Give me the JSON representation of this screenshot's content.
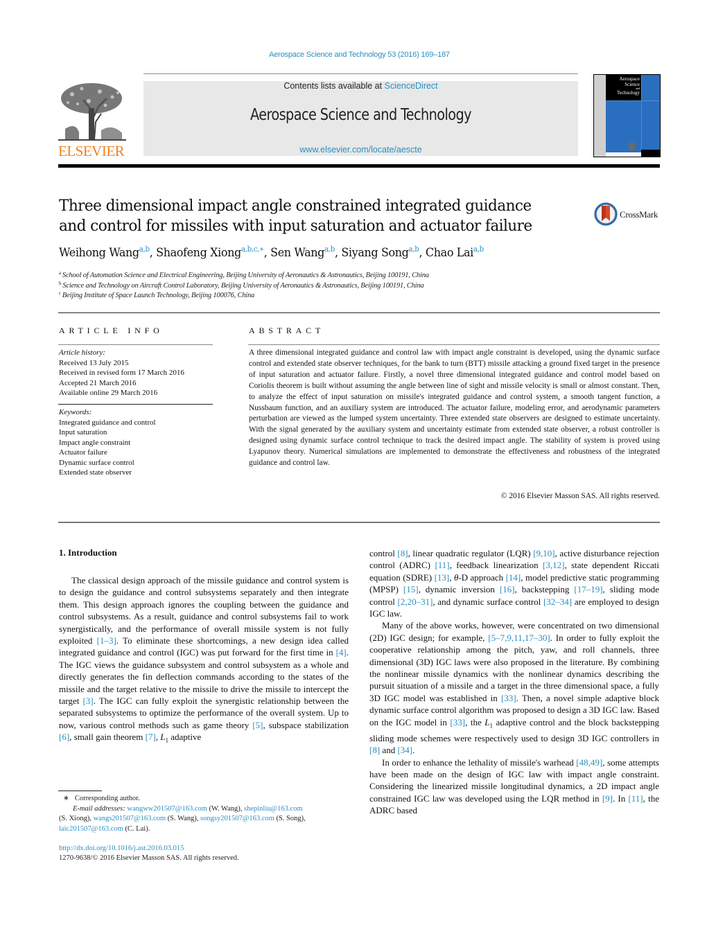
{
  "journal_ref": "Aerospace Science and Technology 53 (2016) 169–187",
  "masthead": {
    "contents_prefix": "Contents lists available at ",
    "contents_link": "ScienceDirect",
    "journal_title": "Aerospace Science and Technology",
    "journal_url": "www.elsevier.com/locate/aescte"
  },
  "publisher_logo_text": "ELSEVIER",
  "cover": {
    "title_line1": "Aerospace",
    "title_line2": "Science",
    "title_line3": "and",
    "title_line4": "Technology"
  },
  "crossmark_label": "CrossMark",
  "title": "Three dimensional impact angle constrained integrated guidance and control for missiles with input saturation and actuator failure",
  "authors": [
    {
      "name": "Weihong Wang",
      "affil": "a,b"
    },
    {
      "name": "Shaofeng Xiong",
      "affil": "a,b,c,∗"
    },
    {
      "name": "Sen Wang",
      "affil": "a,b"
    },
    {
      "name": "Siyang Song",
      "affil": "a,b"
    },
    {
      "name": "Chao Lai",
      "affil": "a,b"
    }
  ],
  "affiliations": [
    {
      "mark": "a",
      "text": "School of Automation Science and Electrical Engineering, Beijing University of Aeronautics & Astronautics, Beijing 100191, China"
    },
    {
      "mark": "b",
      "text": "Science and Technology on Aircraft Control Laboratory, Beijing University of Aeronautics & Astronautics, Beijing 100191, China"
    },
    {
      "mark": "c",
      "text": "Beijing Institute of Space Launch Technology, Beijing 100076, China"
    }
  ],
  "article_info": {
    "heading": "ARTICLE INFO",
    "history_label": "Article history:",
    "history": [
      "Received 13 July 2015",
      "Received in revised form 17 March 2016",
      "Accepted 21 March 2016",
      "Available online 29 March 2016"
    ],
    "keywords_label": "Keywords:",
    "keywords": [
      "Integrated guidance and control",
      "Input saturation",
      "Impact angle constraint",
      "Actuator failure",
      "Dynamic surface control",
      "Extended state observer"
    ]
  },
  "abstract": {
    "heading": "ABSTRACT",
    "text": "A three dimensional integrated guidance and control law with impact angle constraint is developed, using the dynamic surface control and extended state observer techniques, for the bank to turn (BTT) missile attacking a ground fixed target in the presence of input saturation and actuator failure. Firstly, a novel three dimensional integrated guidance and control model based on Coriolis theorem is built without assuming the angle between line of sight and missile velocity is small or almost constant. Then, to analyze the effect of input saturation on missile's integrated guidance and control system, a smooth tangent function, a Nussbaum function, and an auxiliary system are introduced. The actuator failure, modeling error, and aerodynamic parameters perturbation are viewed as the lumped system uncertainty. Three extended state observers are designed to estimate uncertainty. With the signal generated by the auxiliary system and uncertainty estimate from extended state observer, a robust controller is designed using dynamic surface control technique to track the desired impact angle. The stability of system is proved using Lyapunov theory. Numerical simulations are implemented to demonstrate the effectiveness and robustness of the integrated guidance and control law.",
    "copyright": "© 2016 Elsevier Masson SAS. All rights reserved."
  },
  "intro": {
    "heading": "1. Introduction",
    "left": {
      "p1_a": "The classical design approach of the missile guidance and control system is to design the guidance and control subsystems separately and then integrate them. This design approach ignores the coupling between the guidance and control subsystems. As a result, guidance and control subsystems fail to work synergistically, and the performance of overall missile system is not fully exploited ",
      "ref_1_3": "[1–3]",
      "p1_b": ". To eliminate these shortcomings, a new design idea called integrated guidance and control (IGC) was put forward for the first time in ",
      "ref_4": "[4]",
      "p1_c": ". The IGC views the guidance subsystem and control subsystem as a whole and directly generates the fin deflection commands according to the states of the missile and the target relative to the missile to drive the missile to intercept the target ",
      "ref_3": "[3]",
      "p1_d": ". The IGC can fully exploit the synergistic relationship between the separated subsystems to optimize the performance of the overall system. Up to now, various control methods such as game theory ",
      "ref_5": "[5]",
      "p1_e": ", subspace stabilization ",
      "ref_6": "[6]",
      "p1_f": ", small gain theorem ",
      "ref_7": "[7]",
      "p1_g": ", ",
      "l1_sym": "L",
      "l1_sub": "1",
      "p1_h": " adaptive"
    },
    "right": {
      "p1_a": "control ",
      "ref_8": "[8]",
      "p1_b": ", linear quadratic regulator (LQR) ",
      "ref_9_10": "[9,10]",
      "p1_c": ", active disturbance rejection control (ADRC) ",
      "ref_11": "[11]",
      "p1_d": ", feedback linearization ",
      "ref_3_12": "[3,12]",
      "p1_e": ", state dependent Riccati equation (SDRE) ",
      "ref_13": "[13]",
      "p1_f": ", ",
      "theta": "θ",
      "p1_g": "-D approach ",
      "ref_14": "[14]",
      "p1_h": ", model predictive static programming (MPSP) ",
      "ref_15": "[15]",
      "p1_i": ", dynamic inversion ",
      "ref_16": "[16]",
      "p1_j": ", backstepping ",
      "ref_17_19": "[17–19]",
      "p1_k": ", sliding mode control ",
      "ref_2_20_31": "[2,20–31]",
      "p1_l": ", and dynamic surface control ",
      "ref_32_34": "[32–34]",
      "p1_m": " are employed to design IGC law.",
      "p2_a": "Many of the above works, however, were concentrated on two dimensional (2D) IGC design; for example, ",
      "ref_5_30": "[5–7,9,11,17–30]",
      "p2_b": ". In order to fully exploit the cooperative relationship among the pitch, yaw, and roll channels, three dimensional (3D) IGC laws were also proposed in the literature. By combining the nonlinear missile dynamics with the nonlinear dynamics describing the pursuit situation of a missile and a target in the three dimensional space, a fully 3D IGC model was established in ",
      "ref_33a": "[33]",
      "p2_c": ". Then, a novel simple adaptive block dynamic surface control algorithm was proposed to design a 3D IGC law. Based on the IGC model in ",
      "ref_33b": "[33]",
      "p2_d": ", the ",
      "l1_sym": "L",
      "l1_sub": "1",
      "p2_e": " adaptive control and the block backstepping sliding mode schemes were respectively used to design 3D IGC controllers in ",
      "p2_f": " and ",
      "ref_34": "[34]",
      "p2_g": ".",
      "p3_a": "In order to enhance the lethality of missile's warhead ",
      "ref_48_49": "[48,49]",
      "p3_b": ", some attempts have been made on the design of IGC law with impact angle constraint. Considering the linearized missile longitudinal dynamics, a 2D impact angle constrained IGC law was developed using the LQR method in ",
      "ref_9": "[9]",
      "p3_c": ". In ",
      "p3_d": ", the ADRC based"
    }
  },
  "footnotes": {
    "star": "∗",
    "corresponding": "Corresponding author.",
    "email_label": "E-mail addresses:",
    "emails": [
      {
        "addr": "wangww201507@163.com",
        "who": " (W. Wang), "
      },
      {
        "addr": "shepinliu@163.com",
        "who": " (S. Xiong), "
      },
      {
        "addr": "wangs201507@163.com",
        "who": " (S. Wang), "
      },
      {
        "addr": "songsy201507@163.com",
        "who": " (S. Song), "
      },
      {
        "addr": "laic201507@163.com",
        "who": " (C. Lai)."
      }
    ],
    "doi": "http://dx.doi.org/10.1016/j.ast.2016.03.015",
    "issn": "1270-9638/© 2016 Elsevier Masson SAS. All rights reserved."
  },
  "colors": {
    "link": "#2a8fc1",
    "elsevier_orange": "#f0821e",
    "cover_blue": "#2a6fbf",
    "masthead_gray": "#e8e8e8"
  }
}
